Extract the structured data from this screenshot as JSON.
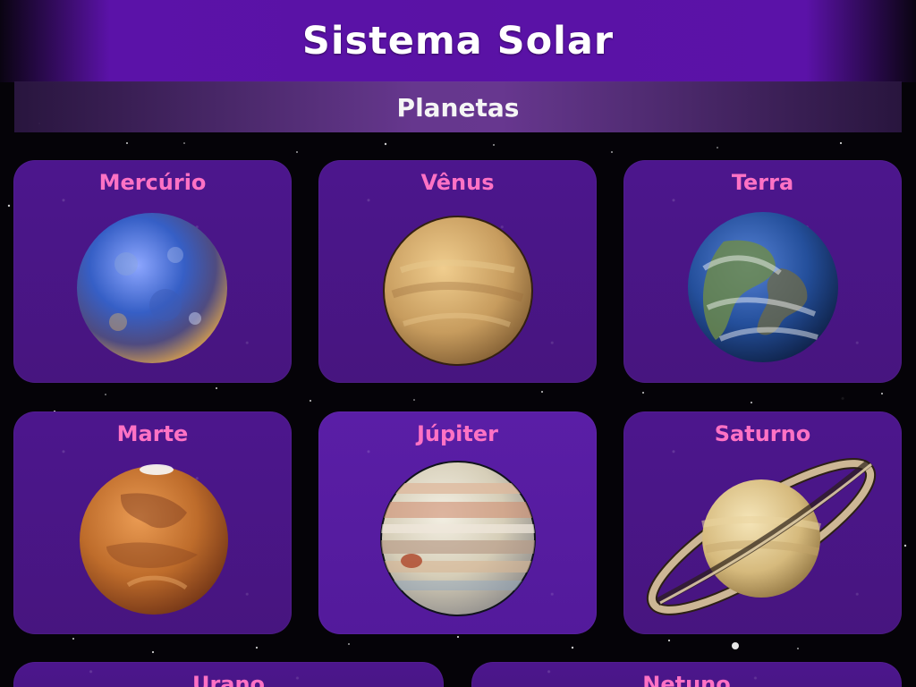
{
  "header": {
    "title": "Sistema Solar",
    "subtitle": "Planetas"
  },
  "planets": [
    {
      "name": "Mercúrio",
      "icon": "mercury-planet-icon"
    },
    {
      "name": "Vênus",
      "icon": "venus-planet-icon"
    },
    {
      "name": "Terra",
      "icon": "earth-planet-icon"
    },
    {
      "name": "Marte",
      "icon": "mars-planet-icon"
    },
    {
      "name": "Júpiter",
      "icon": "jupiter-planet-icon"
    },
    {
      "name": "Saturno",
      "icon": "saturn-planet-icon"
    },
    {
      "name": "Urano",
      "icon": "uranus-planet-icon"
    },
    {
      "name": "Netuno",
      "icon": "neptune-planet-icon"
    }
  ],
  "colors": {
    "header_purple": "#5a12a5",
    "card_purple": "#4c168d",
    "active_card_purple": "#5a1ea6",
    "planet_label_pink": "#ff72c4",
    "title_white": "#ffffff"
  }
}
